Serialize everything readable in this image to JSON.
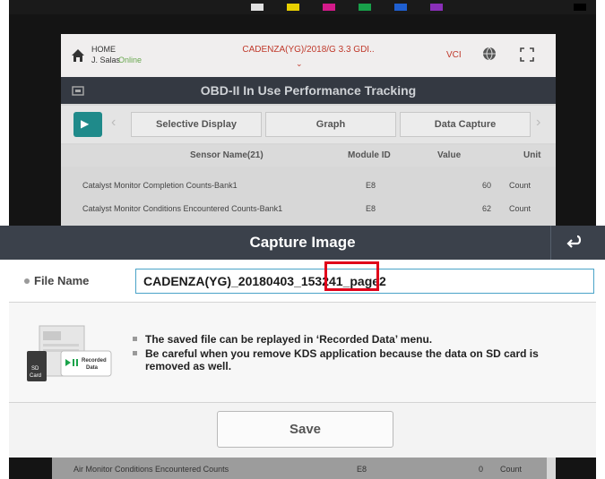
{
  "background_app": {
    "home_label": "HOME",
    "user_name": "J. Salas",
    "status": "Online",
    "vehicle": "CADENZA(YG)/2018/G 3.3 GDI..",
    "vci_label": "VCI",
    "screen_title": "OBD-II In Use Performance Tracking",
    "tabs": [
      {
        "label": "Selective Display"
      },
      {
        "label": "Graph"
      },
      {
        "label": "Data Capture"
      }
    ],
    "table": {
      "headers": [
        "Sensor Name(21)",
        "Module ID",
        "Value",
        "Unit"
      ],
      "rows": [
        {
          "name": "Catalyst Monitor Completion Counts-Bank1",
          "module": "E8",
          "value": "60",
          "unit": "Count"
        },
        {
          "name": "Catalyst Monitor Conditions Encountered Counts-Bank1",
          "module": "E8",
          "value": "62",
          "unit": "Count"
        }
      ],
      "bottom_row": {
        "name": "Air Monitor Conditions Encountered Counts",
        "module": "E8",
        "value": "0",
        "unit": "Count"
      }
    }
  },
  "modal": {
    "title": "Capture Image",
    "file_name_label": "File Name",
    "file_name_value": "CADENZA(YG)_20180403_153241_page2",
    "graphic": {
      "recorded_label": "Recorded Data",
      "sd_label": "SD Card"
    },
    "notes": [
      "The saved file can be replayed in ‘Recorded Data’ menu.",
      "Be careful when you remove KDS application because the data on SD card is removed as well."
    ],
    "save_label": "Save"
  },
  "colors": {
    "modal_header": "#3b414b",
    "highlight_border": "#e0001a",
    "input_border": "#4aa3c8",
    "accent_teal": "#1f8a8a"
  },
  "icons": [
    "home-icon",
    "globe-icon",
    "expand-icon",
    "back-arrow-icon",
    "return-icon",
    "sd-card-icon",
    "play-icon"
  ]
}
